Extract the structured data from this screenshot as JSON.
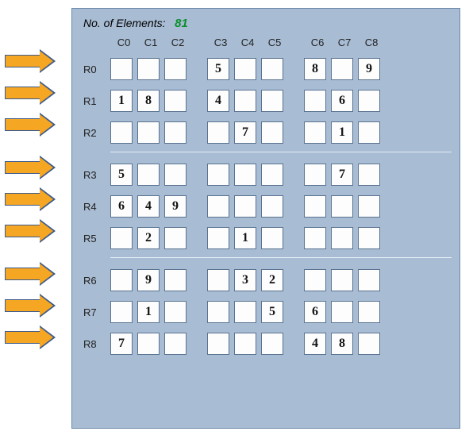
{
  "header": {
    "label": "No. of Elements:",
    "count": "81"
  },
  "columns": [
    "C0",
    "C1",
    "C2",
    "C3",
    "C4",
    "C5",
    "C6",
    "C7",
    "C8"
  ],
  "rows": [
    "R0",
    "R1",
    "R2",
    "R3",
    "R4",
    "R5",
    "R6",
    "R7",
    "R8"
  ],
  "grid": [
    [
      "",
      "",
      "",
      "5",
      "",
      "",
      "8",
      "",
      "9"
    ],
    [
      "1",
      "8",
      "",
      "4",
      "",
      "",
      "",
      "6",
      ""
    ],
    [
      "",
      "",
      "",
      "",
      "7",
      "",
      "",
      "1",
      ""
    ],
    [
      "5",
      "",
      "",
      "",
      "",
      "",
      "",
      "7",
      ""
    ],
    [
      "6",
      "4",
      "9",
      "",
      "",
      "",
      "",
      "",
      ""
    ],
    [
      "",
      "2",
      "",
      "",
      "1",
      "",
      "",
      "",
      ""
    ],
    [
      "",
      "9",
      "",
      "",
      "3",
      "2",
      "",
      "",
      ""
    ],
    [
      "",
      "1",
      "",
      "",
      "",
      "5",
      "6",
      "",
      ""
    ],
    [
      "7",
      "",
      "",
      "",
      "",
      "",
      "4",
      "8",
      ""
    ]
  ]
}
